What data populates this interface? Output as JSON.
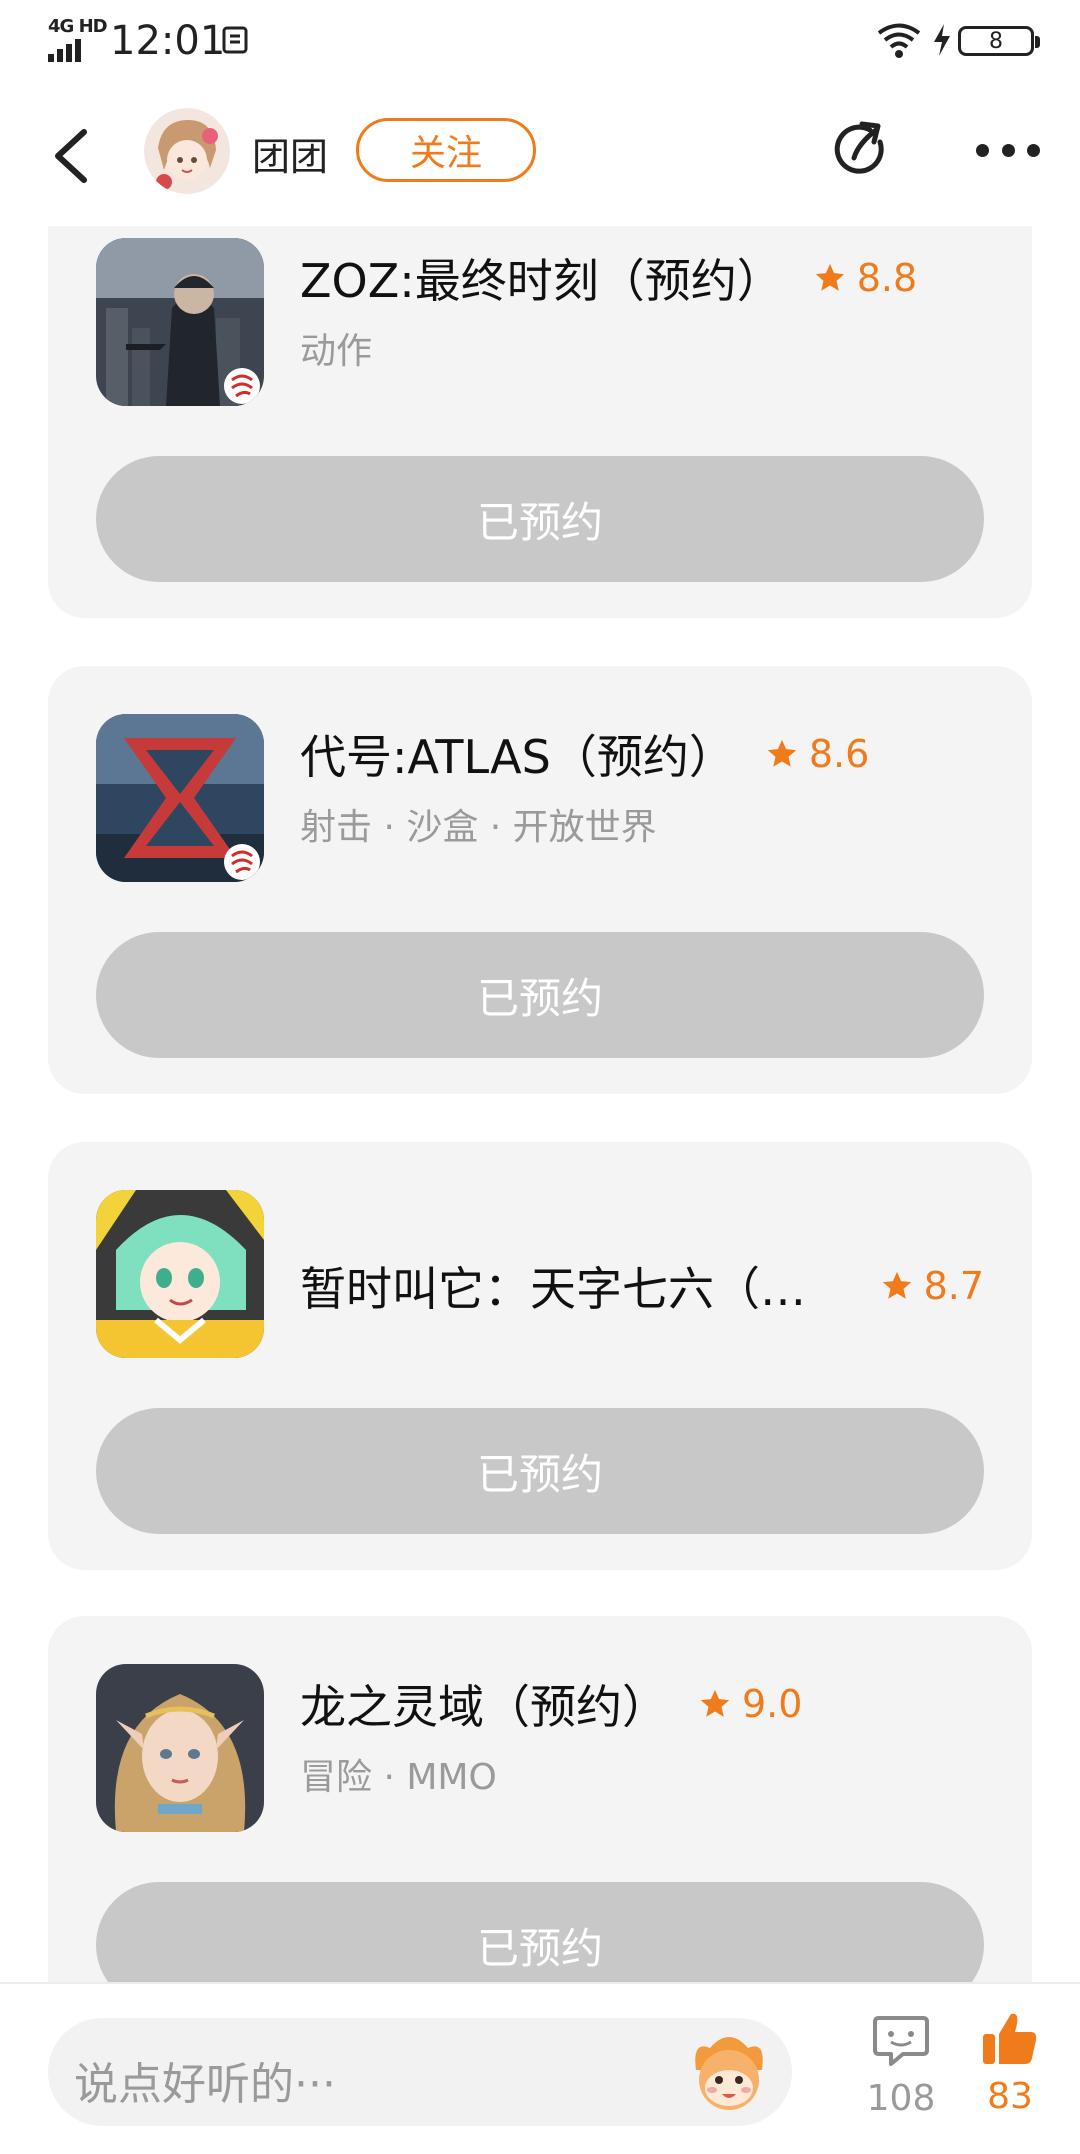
{
  "status_bar": {
    "network": "4G HD",
    "time": "12:01",
    "battery": "8"
  },
  "header": {
    "username": "团团",
    "follow_label": "关注",
    "icons": [
      "back-arrow-icon",
      "avatar",
      "share-icon",
      "more-icon"
    ]
  },
  "games": [
    {
      "title": "ZOZ:最终时刻（预约）",
      "rating": "8.8",
      "tags": "动作",
      "button": "已预约"
    },
    {
      "title": "代号:ATLAS（预约）",
      "rating": "8.6",
      "tags": "射击 · 沙盒 · 开放世界",
      "button": "已预约"
    },
    {
      "title": "暂时叫它：天字七六（…",
      "rating": "8.7",
      "tags": "",
      "button": "已预约"
    },
    {
      "title": "龙之灵域（预约）",
      "rating": "9.0",
      "tags": "冒险 · MMO",
      "button": "已预约"
    }
  ],
  "bottom_bar": {
    "comment_placeholder": "说点好听的···",
    "comment_count": "108",
    "like_count": "83"
  },
  "colors": {
    "accent": "#f07b1b",
    "card_bg": "#f4f4f4",
    "button_disabled": "#c8c8c8",
    "muted_text": "#9a9a9a"
  }
}
